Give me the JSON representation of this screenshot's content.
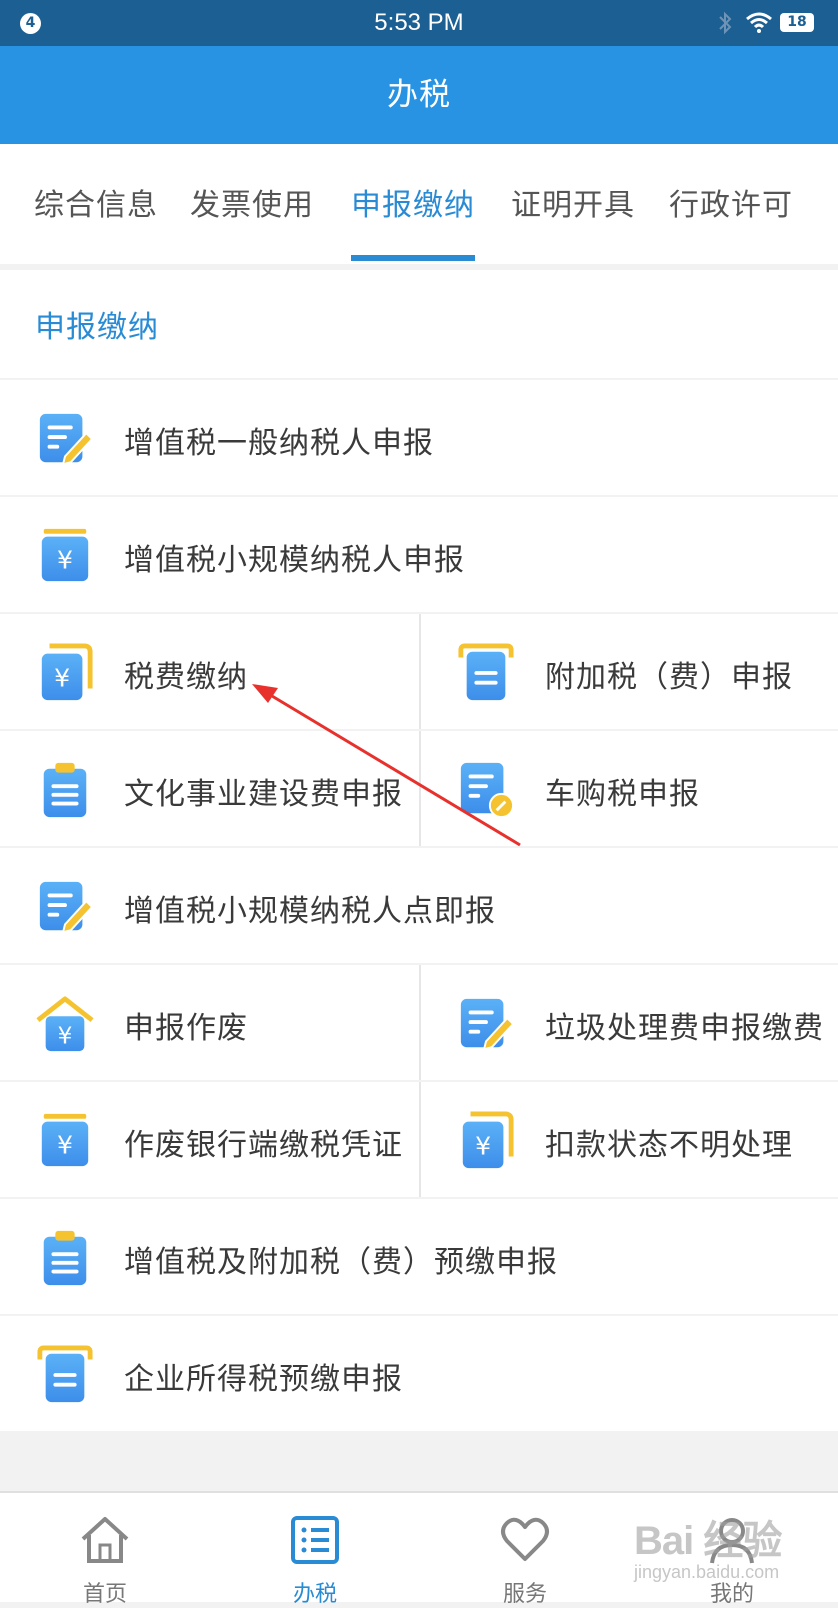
{
  "status_bar": {
    "notification_count": "4",
    "time": "5:53 PM",
    "battery": "18"
  },
  "header": {
    "title": "办税"
  },
  "tabs": [
    {
      "label": "综合信息"
    },
    {
      "label": "发票使用"
    },
    {
      "label": "申报缴纳",
      "active": true
    },
    {
      "label": "证明开具"
    },
    {
      "label": "行政许可"
    }
  ],
  "section": {
    "title": "申报缴纳"
  },
  "items": [
    {
      "label": "增值税一般纳税人申报",
      "icon": "document-pen-icon"
    },
    {
      "label": "增值税小规模纳税人申报",
      "icon": "yuan-card-icon"
    },
    {
      "label": "税费缴纳",
      "icon": "yuan-folder-icon"
    },
    {
      "label": "附加税（费）申报",
      "icon": "folder-doc-icon"
    },
    {
      "label": "文化事业建设费申报",
      "icon": "clipboard-icon"
    },
    {
      "label": "车购税申报",
      "icon": "doc-stamp-icon"
    },
    {
      "label": "增值税小规模纳税人点即报",
      "icon": "document-pen-icon"
    },
    {
      "label": "申报作废",
      "icon": "yuan-house-icon"
    },
    {
      "label": "垃圾处理费申报缴费",
      "icon": "document-pen-icon"
    },
    {
      "label": "作废银行端缴税凭证",
      "icon": "yuan-card-icon"
    },
    {
      "label": "扣款状态不明处理",
      "icon": "yuan-folder-icon"
    },
    {
      "label": "增值税及附加税（费）预缴申报",
      "icon": "clipboard-icon"
    },
    {
      "label": "企业所得税预缴申报",
      "icon": "folder-doc-icon"
    }
  ],
  "tab_bar": [
    {
      "label": "首页",
      "icon": "home-icon"
    },
    {
      "label": "办税",
      "icon": "list-icon",
      "active": true
    },
    {
      "label": "服务",
      "icon": "heart-icon"
    },
    {
      "label": "我的",
      "icon": "user-icon"
    }
  ],
  "watermark": {
    "brand": "Bai 经验",
    "url": "jingyan.baidu.com"
  },
  "colors": {
    "primary": "#2893e3",
    "status_bar": "#1b5f93",
    "accent_text": "#2a8bd5",
    "icon_blue": "#4aa0f0",
    "icon_yellow": "#f5c330",
    "annotation_arrow": "#e8312c"
  }
}
